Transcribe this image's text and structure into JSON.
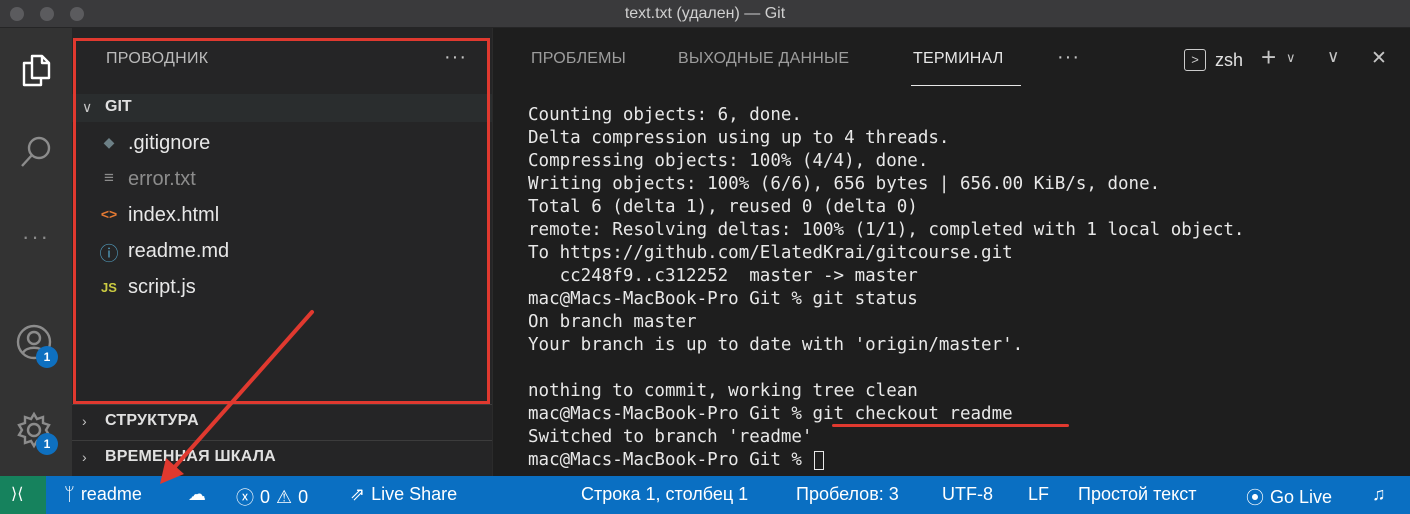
{
  "window": {
    "title": "text.txt (удален) — Git"
  },
  "colors": {
    "statusbar": "#0a6fc2",
    "remote": "#16825d",
    "annotation": "#e0392f",
    "badge": "#0e70c0"
  },
  "activity_bar": {
    "icons": [
      "files-icon",
      "search-icon",
      "more-icon",
      "account-icon",
      "gear-icon"
    ],
    "account_badge": "1",
    "settings_badge": "1",
    "more_glyph": "···"
  },
  "sidebar": {
    "header": "ПРОВОДНИК",
    "dots": "···",
    "folder": "GIT",
    "files": [
      {
        "name": ".gitignore",
        "icon": "git-file-icon",
        "glyph": "◆",
        "color": "#6d8086",
        "deleted": false
      },
      {
        "name": "error.txt",
        "icon": "text-file-icon",
        "glyph": "≡",
        "color": "#8c8c8c",
        "deleted": true
      },
      {
        "name": "index.html",
        "icon": "html-file-icon",
        "glyph": "<>",
        "color": "#e37933",
        "deleted": false
      },
      {
        "name": "readme.md",
        "icon": "info-file-icon",
        "glyph": "ⓘ",
        "color": "#519aba",
        "deleted": false
      },
      {
        "name": "script.js",
        "icon": "js-file-icon",
        "glyph": "JS",
        "color": "#cbcb41",
        "deleted": false
      }
    ],
    "sections": [
      "СТРУКТУРА",
      "ВРЕМЕННАЯ ШКАЛА"
    ]
  },
  "panel": {
    "tabs": [
      "ПРОБЛЕМЫ",
      "ВЫХОДНЫЕ ДАННЫЕ",
      "ТЕРМИНАЛ"
    ],
    "active_tab": "ТЕРМИНАЛ",
    "more": "···",
    "shell_glyph": ">",
    "shell": "zsh",
    "add_glyph": "+",
    "split_glyph": "∨",
    "maximize_glyph": "∨",
    "close_glyph": "✕"
  },
  "terminal": {
    "lines": [
      "Counting objects: 6, done.",
      "Delta compression using up to 4 threads.",
      "Compressing objects: 100% (4/4), done.",
      "Writing objects: 100% (6/6), 656 bytes | 656.00 KiB/s, done.",
      "Total 6 (delta 1), reused 0 (delta 0)",
      "remote: Resolving deltas: 100% (1/1), completed with 1 local object.",
      "To https://github.com/ElatedKrai/gitcourse.git",
      "   cc248f9..c312252  master -> master",
      "mac@Macs-MacBook-Pro Git % git status",
      "On branch master",
      "Your branch is up to date with 'origin/master'.",
      "",
      "nothing to commit, working tree clean",
      "mac@Macs-MacBook-Pro Git % git checkout readme",
      "Switched to branch 'readme'"
    ],
    "prompt": "mac@Macs-MacBook-Pro Git % "
  },
  "statusbar": {
    "remote_glyph": "⟩⟨",
    "branch": "readme",
    "branch_glyph": "ᛘ",
    "sync_glyph": "☁",
    "errors": "0",
    "warnings": "0",
    "errors_glyph": "ⓧ",
    "warnings_glyph": "⚠",
    "liveshare_glyph": "⇗",
    "liveshare": "Live Share",
    "position": "Строка 1, столбец 1",
    "spaces": "Пробелов: 3",
    "encoding": "UTF-8",
    "eol": "LF",
    "language": "Простой текст",
    "golive_glyph": "⦿",
    "golive": "Go Live",
    "bell_glyph": "♫"
  }
}
